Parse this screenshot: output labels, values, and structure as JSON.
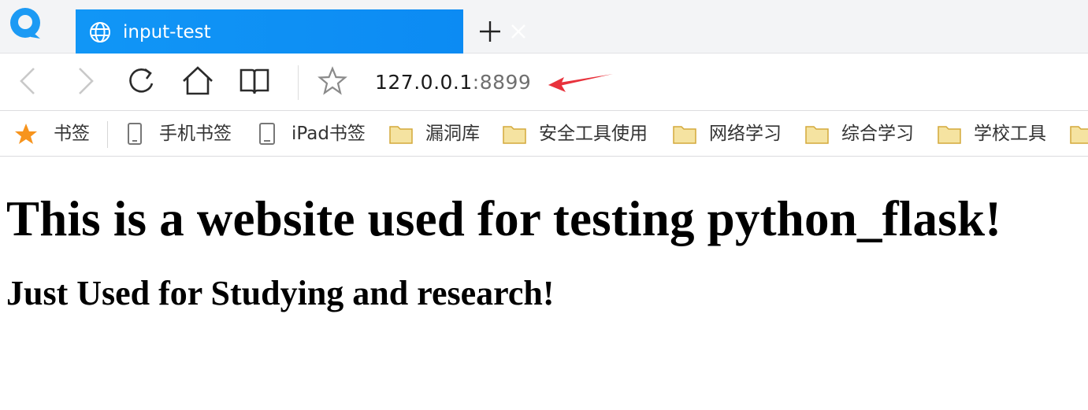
{
  "browser": {
    "tab": {
      "title": "input-test"
    },
    "address": {
      "host": "127.0.0.1",
      "separator": ":",
      "port": "8899"
    },
    "bookmarks": [
      {
        "label": "书签",
        "icon": "star-icon"
      },
      {
        "label": "手机书签",
        "icon": "phone-icon"
      },
      {
        "label": "iPad书签",
        "icon": "tablet-icon"
      },
      {
        "label": "漏洞库",
        "icon": "folder-icon"
      },
      {
        "label": "安全工具使用",
        "icon": "folder-icon"
      },
      {
        "label": "网络学习",
        "icon": "folder-icon"
      },
      {
        "label": "综合学习",
        "icon": "folder-icon"
      },
      {
        "label": "学校工具",
        "icon": "folder-icon"
      }
    ],
    "colors": {
      "tab_active": "#0c8bf3",
      "star": "#f7941d",
      "folder": "#f5e3a1",
      "annotation_arrow": "#e8323c"
    }
  },
  "page": {
    "heading": "This is a website used for testing python_flask!",
    "subheading": "Just Used for Studying and research!"
  }
}
